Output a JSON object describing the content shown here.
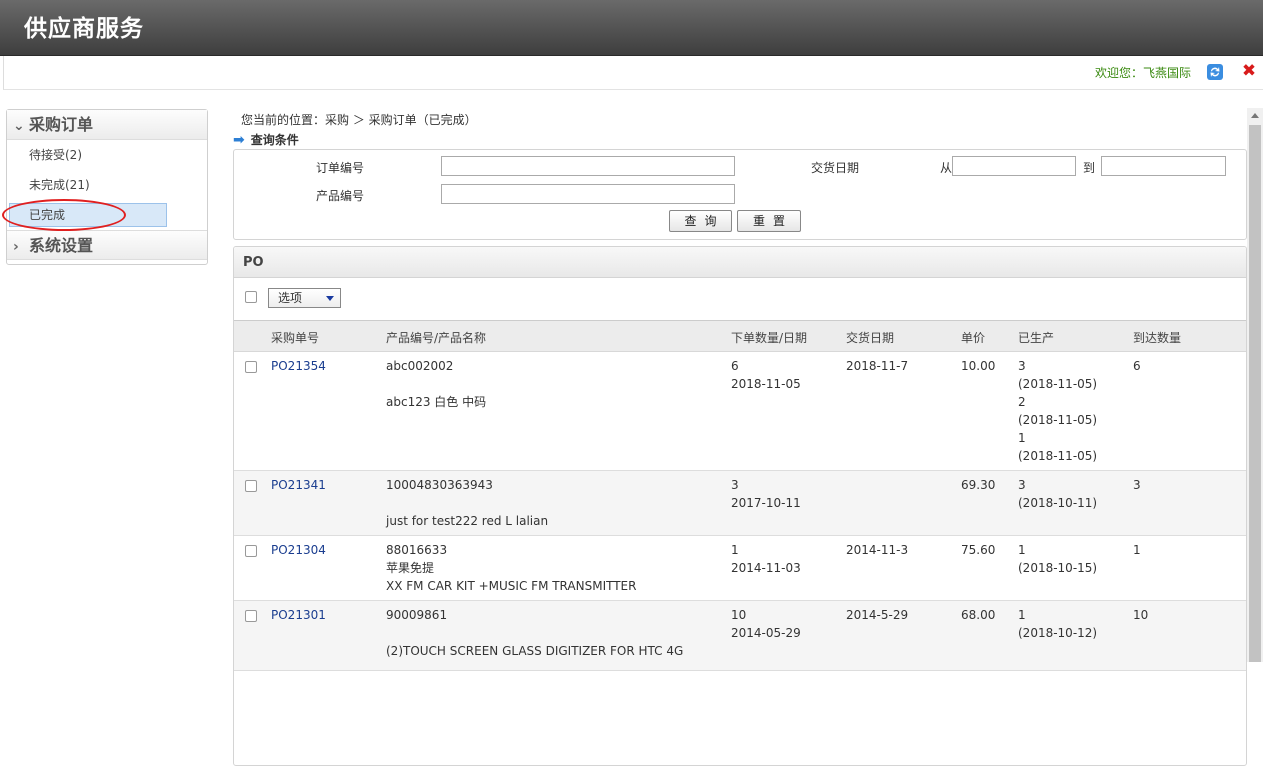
{
  "app": {
    "title": "供应商服务"
  },
  "topbar": {
    "welcome": "欢迎您：飞燕国际",
    "refresh_icon": "refresh-icon",
    "close_icon": "close-icon"
  },
  "sidebar": {
    "group1": "采购订单",
    "items": [
      {
        "label": "待接受(2)"
      },
      {
        "label": "未完成(21)"
      },
      {
        "label": "已完成"
      }
    ],
    "group2": "系统设置"
  },
  "breadcrumb": "您当前的位置：采购 ＞ 采购订单（已完成）",
  "query": {
    "title": "查询条件",
    "order_no_label": "订单编号",
    "product_no_label": "产品编号",
    "delivery_date_label": "交货日期",
    "from_label": "从",
    "to_label": "到",
    "search_button": "查询",
    "reset_button": "重置"
  },
  "po": {
    "title": "PO",
    "options_label": "选项",
    "columns": [
      "采购单号",
      "产品编号/产品名称",
      "下单数量/日期",
      "交货日期",
      "单价",
      "已生产",
      "到达数量"
    ],
    "rows": [
      {
        "po": "PO21354",
        "product": [
          "abc002002",
          "",
          "abc123 白色 中码"
        ],
        "qty_date": [
          "6",
          "2018-11-05"
        ],
        "delivery": "2018-11-7",
        "price": "10.00",
        "produced": [
          "3",
          "(2018-11-05)",
          "2",
          "(2018-11-05)",
          "1",
          "(2018-11-05)"
        ],
        "arrived": "6"
      },
      {
        "po": "PO21341",
        "product": [
          "10004830363943",
          "",
          "just for test222 red L lalian"
        ],
        "qty_date": [
          "3",
          "2017-10-11"
        ],
        "delivery": "",
        "price": "69.30",
        "produced": [
          "3",
          "(2018-10-11)"
        ],
        "arrived": "3"
      },
      {
        "po": "PO21304",
        "product": [
          "88016633",
          "苹果免提",
          "XX FM CAR KIT +MUSIC FM TRANSMITTER"
        ],
        "qty_date": [
          "1",
          "2014-11-03"
        ],
        "delivery": "2014-11-3",
        "price": "75.60",
        "produced": [
          "1",
          "(2018-10-15)"
        ],
        "arrived": "1"
      },
      {
        "po": "PO21301",
        "product": [
          "90009861",
          "",
          "(2)TOUCH SCREEN GLASS DIGITIZER FOR HTC 4G"
        ],
        "qty_date": [
          "10",
          "2014-05-29"
        ],
        "delivery": "2014-5-29",
        "price": "68.00",
        "produced": [
          "1",
          "(2018-10-12)"
        ],
        "arrived": "10"
      }
    ]
  },
  "colors": {
    "header_bg": "#4a4a4a",
    "welcome": "#3a8a10",
    "link": "#1a3d8f",
    "annotation": "#e02020"
  }
}
